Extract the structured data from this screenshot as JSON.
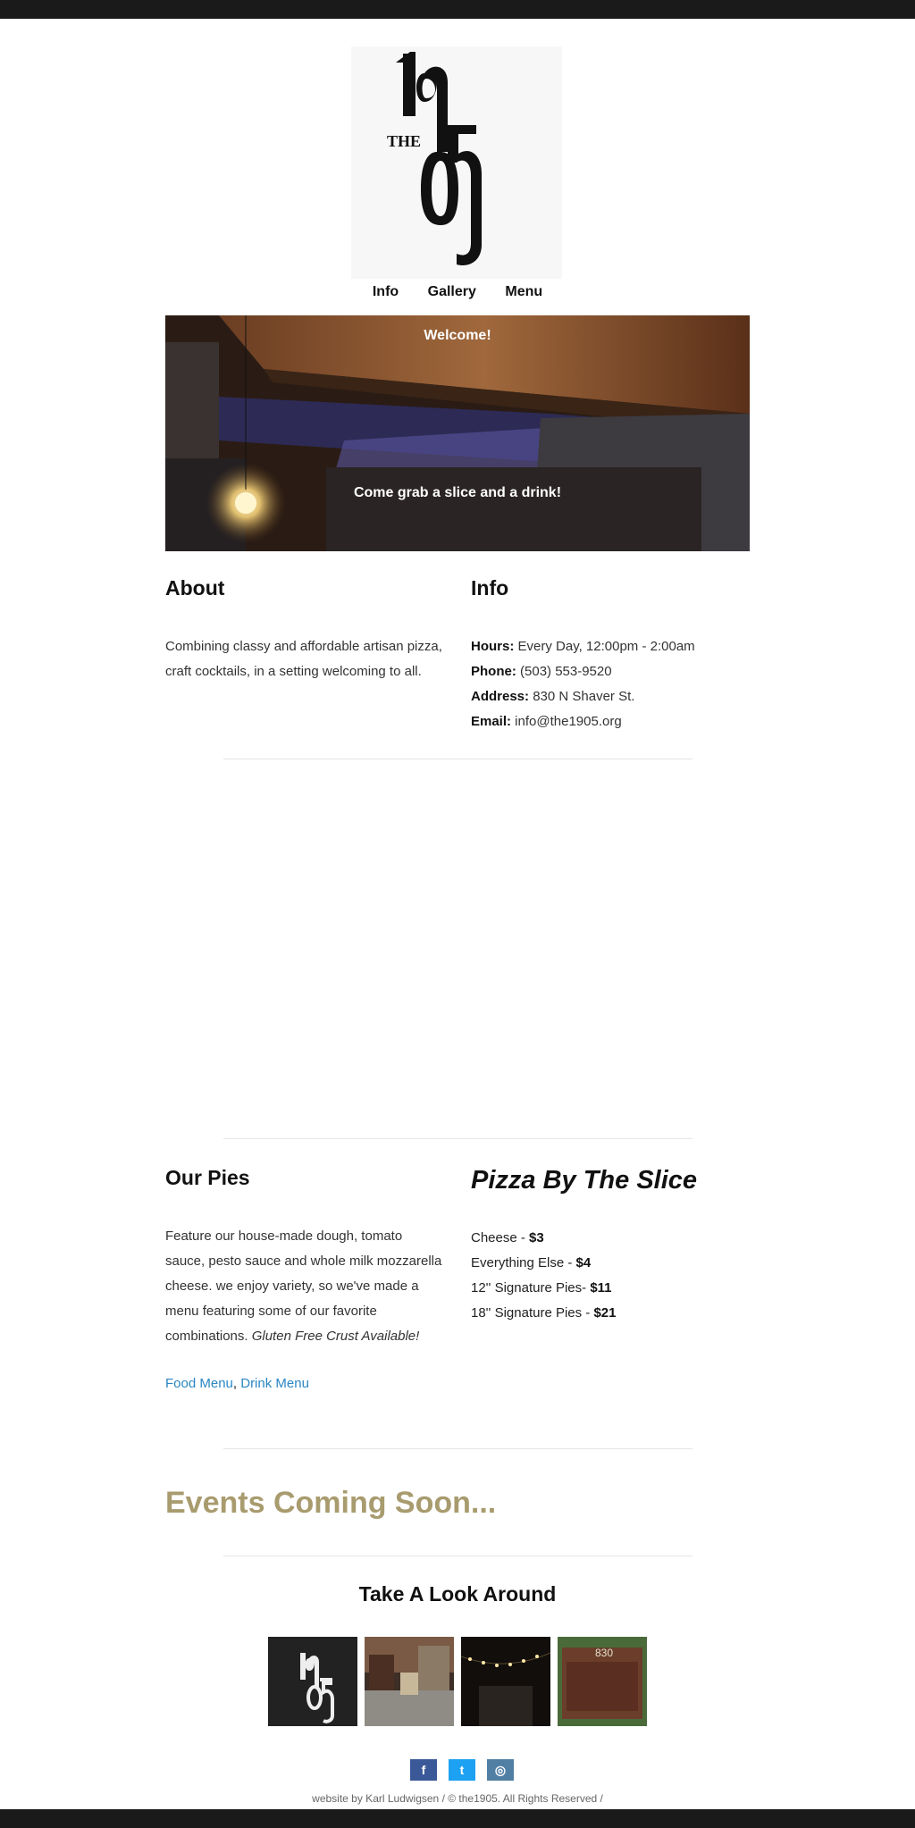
{
  "logo": {
    "text_the": "THE",
    "text_digits": "1905"
  },
  "nav": {
    "items": [
      "Info",
      "Gallery",
      "Menu"
    ]
  },
  "hero": {
    "welcome": "Welcome!",
    "tagline": "Come grab a slice and a drink!"
  },
  "about": {
    "heading": "About",
    "text": "Combining classy and affordable artisan pizza, craft cocktails, in a setting welcoming to all."
  },
  "info": {
    "heading": "Info",
    "rows": [
      {
        "label": "Hours:",
        "value": " Every Day, 12:00pm - 2:00am"
      },
      {
        "label": "Phone:",
        "value": " (503) 553-9520"
      },
      {
        "label": "Address:",
        "value": " 830 N Shaver St."
      },
      {
        "label": "Email:",
        "value": " info@the1905.org"
      }
    ]
  },
  "pies": {
    "heading": "Our Pies",
    "text": "Feature our house-made dough, tomato sauce, pesto sauce and whole milk mozzarella cheese. we enjoy variety, so we've made a menu featuring some of our favorite combinations. ",
    "text_italic": "Gluten Free Crust Available!",
    "food_menu": "Food Menu",
    "separator": ",",
    "drink_menu": "Drink Menu"
  },
  "slice": {
    "heading": "Pizza By The Slice",
    "rows": [
      {
        "label": "Cheese - ",
        "price": "$3"
      },
      {
        "label": "Everything Else - ",
        "price": "$4"
      },
      {
        "label": "12'' Signature Pies- ",
        "price": "$11"
      },
      {
        "label": "18'' Signature Pies - ",
        "price": "$21"
      }
    ]
  },
  "events": {
    "heading": "Events Coming Soon..."
  },
  "gallery": {
    "heading": "Take A Look Around",
    "sign_number": "830"
  },
  "social": {
    "facebook": "f",
    "twitter": "t",
    "instagram": "◎"
  },
  "footer": {
    "text": "website by Karl Ludwigsen / © the1905. All Rights Reserved  /"
  },
  "colors": {
    "link": "#2a86c4",
    "events": "#a89b6e",
    "facebook": "#3b5998",
    "twitter": "#1da1f2",
    "instagram": "#517fa4",
    "bar": "#1a1a1a"
  }
}
